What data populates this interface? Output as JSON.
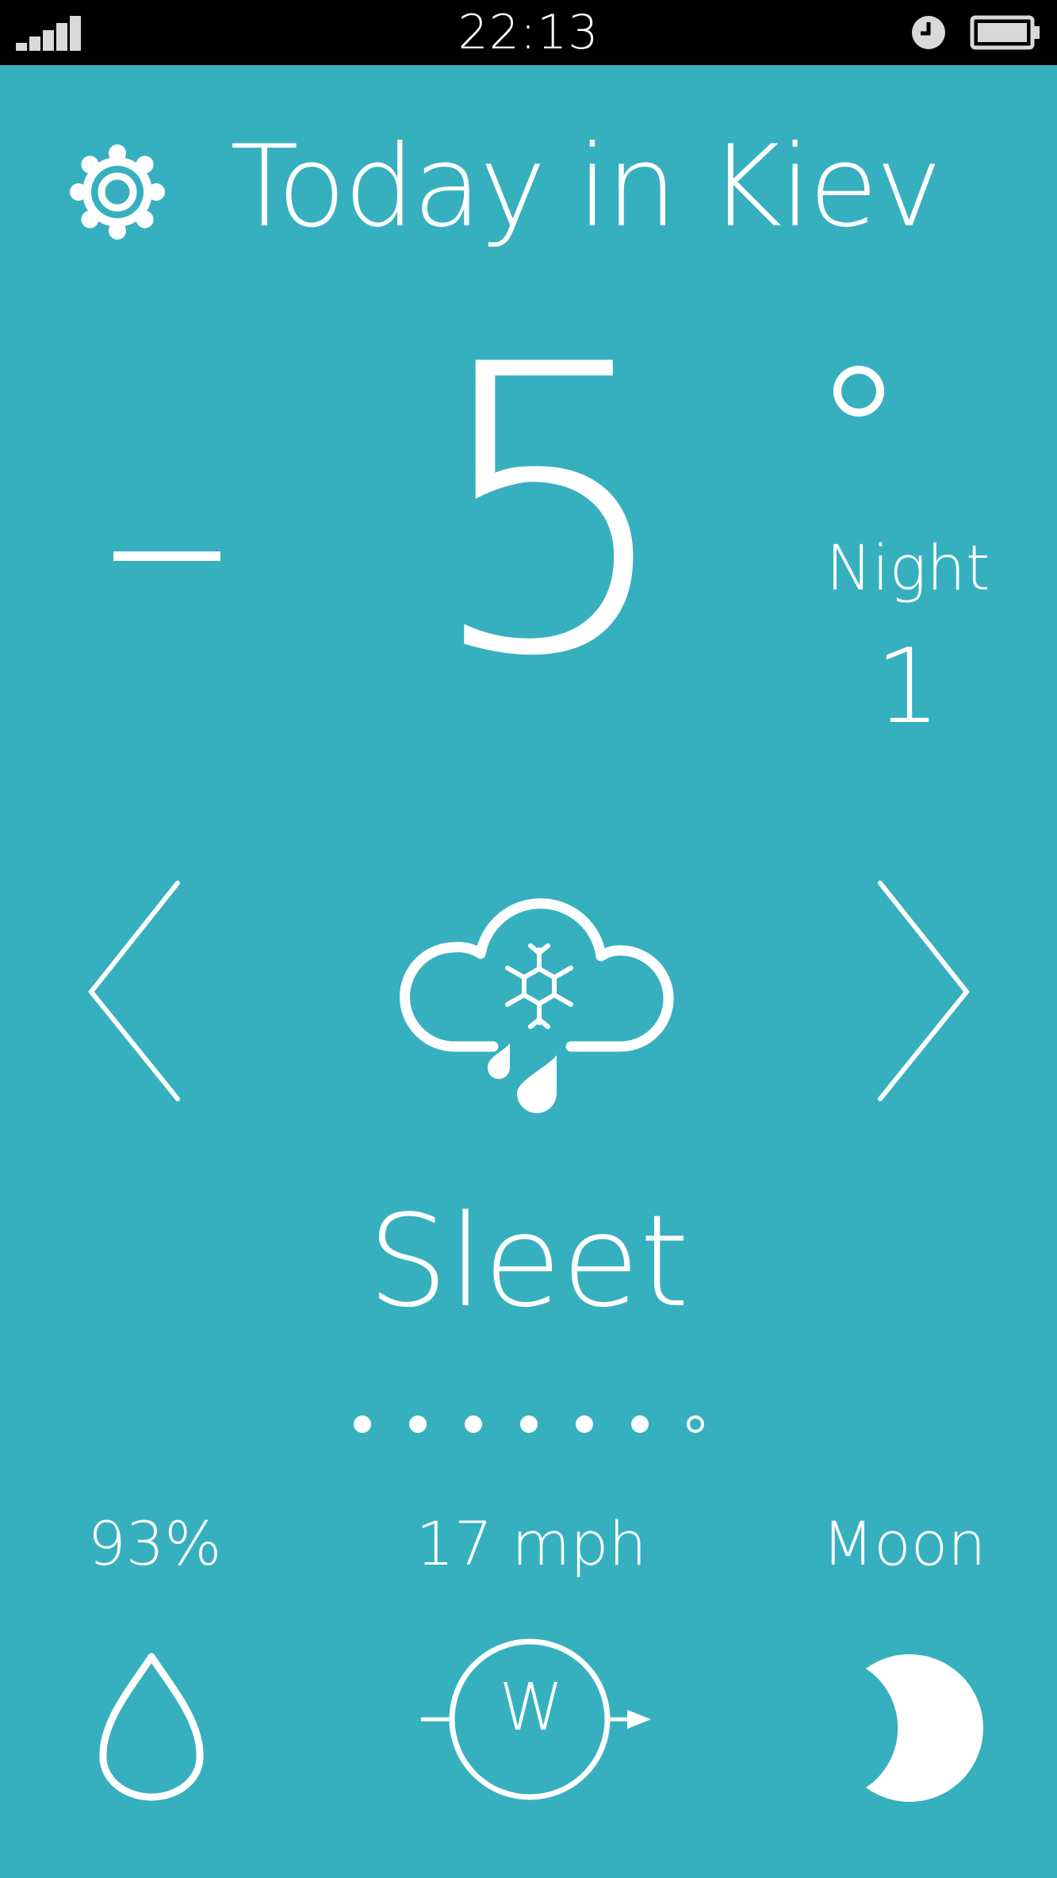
{
  "status_bar": {
    "time": "22:13",
    "icons": [
      "signal-icon",
      "alarm-clock-icon",
      "battery-icon"
    ]
  },
  "header": {
    "title": "Today in Kiev",
    "settings_icon": "gear-icon"
  },
  "temperature": {
    "sign": "−",
    "value": "5",
    "unit_symbol": "°",
    "night_label": "Night",
    "night_value": "1"
  },
  "condition": {
    "label": "Sleet",
    "icon": "sleet-cloud-icon"
  },
  "navigation": {
    "prev_icon": "chevron-left-icon",
    "next_icon": "chevron-right-icon",
    "page_count": 7,
    "current_page": 7
  },
  "stats": {
    "humidity": "93%",
    "humidity_icon": "water-drop-icon",
    "wind_speed": "17 mph",
    "wind_direction": "W",
    "wind_icon": "compass-icon",
    "moon_label": "Moon",
    "moon_icon": "moon-phase-icon"
  },
  "colors": {
    "background": "#36b0bf",
    "foreground": "#ffffff",
    "status_bar": "#000000",
    "status_icons": "#d9d9d9"
  }
}
